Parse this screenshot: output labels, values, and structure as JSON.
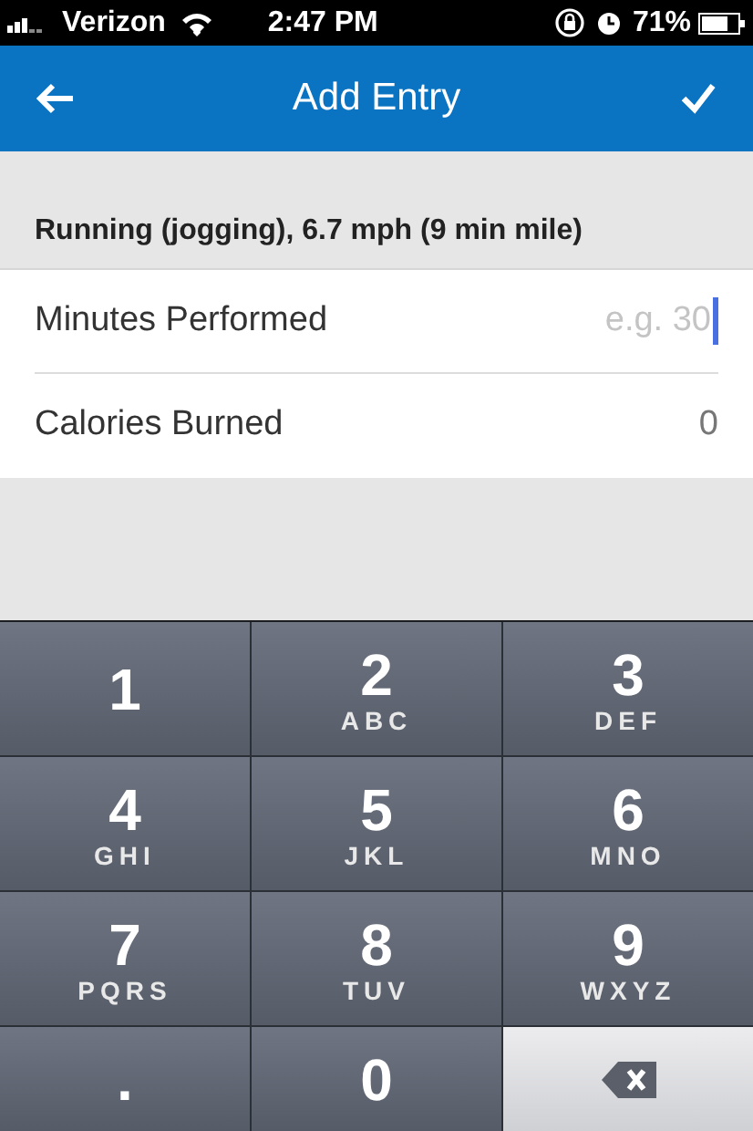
{
  "status_bar": {
    "carrier": "Verizon",
    "time": "2:47 PM",
    "battery": "71%"
  },
  "nav_bar": {
    "title": "Add Entry"
  },
  "section": {
    "title": "Running (jogging), 6.7 mph (9 min mile)"
  },
  "fields": [
    {
      "label": "Minutes Performed",
      "placeholder": "e.g. 30",
      "focused": true
    },
    {
      "label": "Calories Burned",
      "value": "0",
      "focused": false
    }
  ],
  "keypad": [
    {
      "kind": "digit",
      "digit": "1"
    },
    {
      "kind": "digit",
      "digit": "2",
      "letters": "ABC"
    },
    {
      "kind": "digit",
      "digit": "3",
      "letters": "DEF"
    },
    {
      "kind": "digit",
      "digit": "4",
      "letters": "GHI"
    },
    {
      "kind": "digit",
      "digit": "5",
      "letters": "JKL"
    },
    {
      "kind": "digit",
      "digit": "6",
      "letters": "MNO"
    },
    {
      "kind": "digit",
      "digit": "7",
      "letters": "PQRS"
    },
    {
      "kind": "digit",
      "digit": "8",
      "letters": "TUV"
    },
    {
      "kind": "digit",
      "digit": "9",
      "letters": "WXYZ"
    },
    {
      "kind": "digit",
      "digit": "."
    },
    {
      "kind": "digit",
      "digit": "0"
    },
    {
      "kind": "delete"
    }
  ]
}
